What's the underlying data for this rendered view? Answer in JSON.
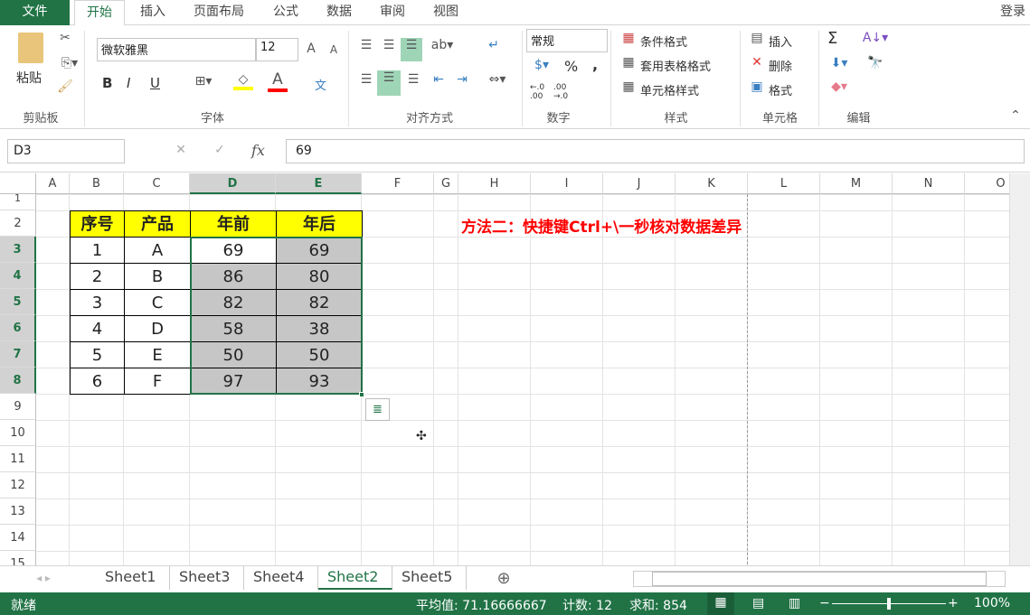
{
  "tabs": {
    "file": "文件",
    "items": [
      "开始",
      "插入",
      "页面布局",
      "公式",
      "数据",
      "审阅",
      "视图"
    ],
    "login": "登录"
  },
  "ribbon": {
    "clipboard": {
      "paste": "粘贴",
      "label": "剪贴板"
    },
    "font": {
      "name": "微软雅黑",
      "size": "12",
      "bold": "B",
      "italic": "I",
      "underline": "U",
      "phonetic": "文",
      "label": "字体",
      "fill_color": "#ffff00",
      "font_color": "#ff0000"
    },
    "alignment": {
      "label": "对齐方式"
    },
    "number": {
      "format": "常规",
      "percent": "%",
      "comma": ",",
      "inc": "←.0 .00",
      "dec": ".00 →.0",
      "label": "数字"
    },
    "styles": {
      "conditional": "条件格式",
      "table": "套用表格格式",
      "cell": "单元格样式",
      "label": "样式"
    },
    "cells": {
      "insert": "插入",
      "delete": "删除",
      "format": "格式",
      "label": "单元格"
    },
    "editing": {
      "sum": "Σ",
      "label": "编辑"
    }
  },
  "formula_bar": {
    "name_box": "D3",
    "fx": "fx",
    "value": "69"
  },
  "columns": [
    "A",
    "B",
    "C",
    "D",
    "E",
    "F",
    "G",
    "H",
    "I",
    "J",
    "K",
    "L",
    "M",
    "N",
    "O"
  ],
  "rows": [
    "1",
    "2",
    "3",
    "4",
    "5",
    "6",
    "7",
    "8",
    "9",
    "10",
    "11",
    "12",
    "13",
    "14",
    "15"
  ],
  "table": {
    "headers": [
      "序号",
      "产品",
      "年前",
      "年后"
    ],
    "rows": [
      [
        "1",
        "A",
        "69",
        "69"
      ],
      [
        "2",
        "B",
        "86",
        "80"
      ],
      [
        "3",
        "C",
        "82",
        "82"
      ],
      [
        "4",
        "D",
        "58",
        "38"
      ],
      [
        "5",
        "E",
        "50",
        "50"
      ],
      [
        "6",
        "F",
        "97",
        "93"
      ]
    ]
  },
  "note": "方法二：快捷键Ctrl+\\一秒核对数据差异",
  "sheets": [
    "Sheet1",
    "Sheet3",
    "Sheet4",
    "Sheet2",
    "Sheet5"
  ],
  "active_sheet": "Sheet2",
  "status": {
    "ready": "就绪",
    "average": "平均值: 71.16666667",
    "count": "计数: 12",
    "sum": "求和: 854",
    "zoom": "100%",
    "zoom_percent": 100
  }
}
